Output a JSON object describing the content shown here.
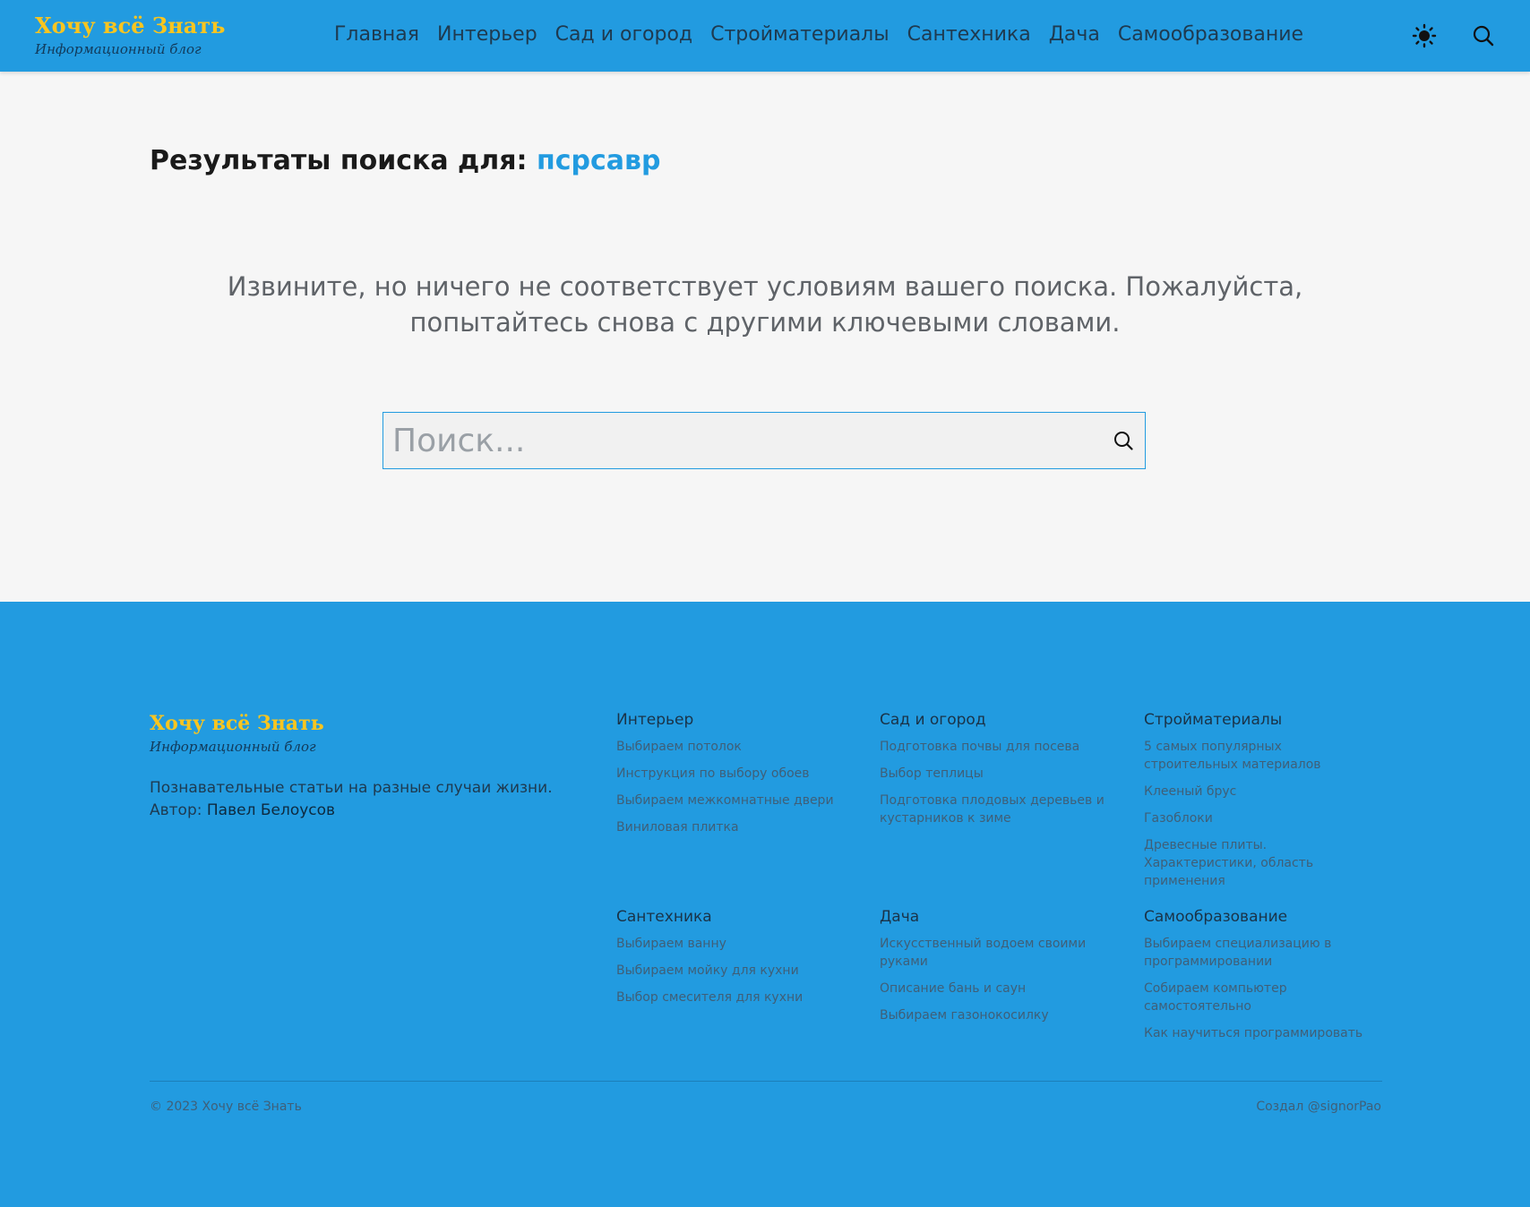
{
  "colors": {
    "brand_blue": "#229be0",
    "logo_yellow": "#f9c51f",
    "page_bg": "#f6f6f6"
  },
  "header": {
    "logo_title": "Хочу всё Знать",
    "logo_subtitle": "Информационный блог",
    "nav": [
      "Главная",
      "Интерьер",
      "Сад и огород",
      "Стройматериалы",
      "Сантехника",
      "Дача",
      "Самообразование"
    ],
    "theme_icon": "sun-icon",
    "search_icon": "search-icon"
  },
  "main": {
    "heading_prefix": "Результаты поиска для:",
    "search_term": "псрсавр",
    "no_results_text": "Извините, но ничего не соответствует условиям вашего поиска. Пожалуйста, попытайтесь снова с другими ключевыми словами.",
    "search_placeholder": "Поиск...",
    "search_value": ""
  },
  "footer": {
    "logo_title": "Хочу всё Знать",
    "logo_subtitle": "Информационный блог",
    "description": "Познавательные статьи на разные случаи жизни.",
    "author_label": "Автор:",
    "author_name": "Павел Белоусов",
    "columns": [
      {
        "title": "Интерьер",
        "links": [
          "Выбираем потолок",
          "Инструкция по выбору обоев",
          "Выбираем межкомнатные двери",
          "Виниловая плитка"
        ]
      },
      {
        "title": "Сад и огород",
        "links": [
          "Подготовка почвы для посева",
          "Выбор теплицы",
          "Подготовка плодовых деревьев и кустарников к зиме"
        ]
      },
      {
        "title": "Стройматериалы",
        "links": [
          "5 самых популярных строительных материалов",
          "Клееный брус",
          "Газоблоки",
          "Древесные плиты. Характеристики, область применения"
        ]
      },
      {
        "title": "Сантехника",
        "links": [
          "Выбираем ванну",
          "Выбираем мойку для кухни",
          "Выбор смесителя для кухни"
        ]
      },
      {
        "title": "Дача",
        "links": [
          "Искусственный водоем своими руками",
          "Описание бань и саун",
          "Выбираем газонокосилку"
        ]
      },
      {
        "title": "Самообразование",
        "links": [
          "Выбираем специализацию в программировании",
          "Собираем компьютер самостоятельно",
          "Как научиться программировать"
        ]
      }
    ],
    "copyright": "© 2023 Хочу всё Знать",
    "credit": "Создал @signorPao"
  }
}
